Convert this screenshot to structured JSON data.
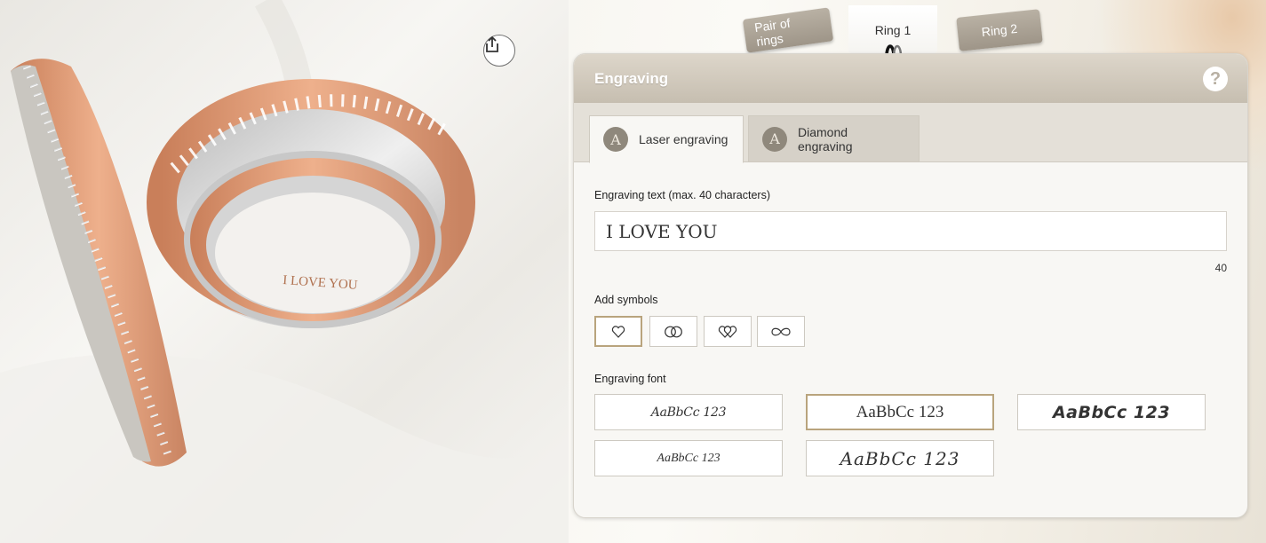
{
  "scene": {
    "ring_engraving": "I LOVE YOU",
    "share_icon": "share-icon"
  },
  "ring_tabs": {
    "pair": "Pair of rings",
    "ring1": "Ring 1",
    "ring2": "Ring 2",
    "active": "Ring 1"
  },
  "panel": {
    "title": "Engraving",
    "help_label": "?",
    "modes": [
      {
        "label": "Laser engraving",
        "icon_letter": "A",
        "active": true
      },
      {
        "label": "Diamond engraving",
        "icon_letter": "A",
        "active": false
      }
    ],
    "text_label": "Engraving text (max. 40 characters)",
    "text_value": "I LOVE YOU",
    "char_count": "40",
    "symbols_label": "Add symbols",
    "symbols": [
      "heart-icon",
      "interlocked-rings-icon",
      "double-heart-icon",
      "infinity-icon"
    ],
    "selected_symbol": "heart-icon",
    "font_label": "Engraving font",
    "fonts": [
      {
        "sample": "AaBbCc 123",
        "style": "script"
      },
      {
        "sample": "AaBbCc 123",
        "style": "serif",
        "selected": true
      },
      {
        "sample": "AaBbCc 123",
        "style": "bold-decorative"
      },
      {
        "sample": "AaBbCc 123",
        "style": "handwriting"
      },
      {
        "sample": "AaBbCc 123",
        "style": "calligraphic"
      }
    ]
  },
  "colors": {
    "accent_border": "#b9a47d",
    "header": "#c6beb0",
    "rose_gold": "#d9946f",
    "silver": "#d8d8d8"
  }
}
